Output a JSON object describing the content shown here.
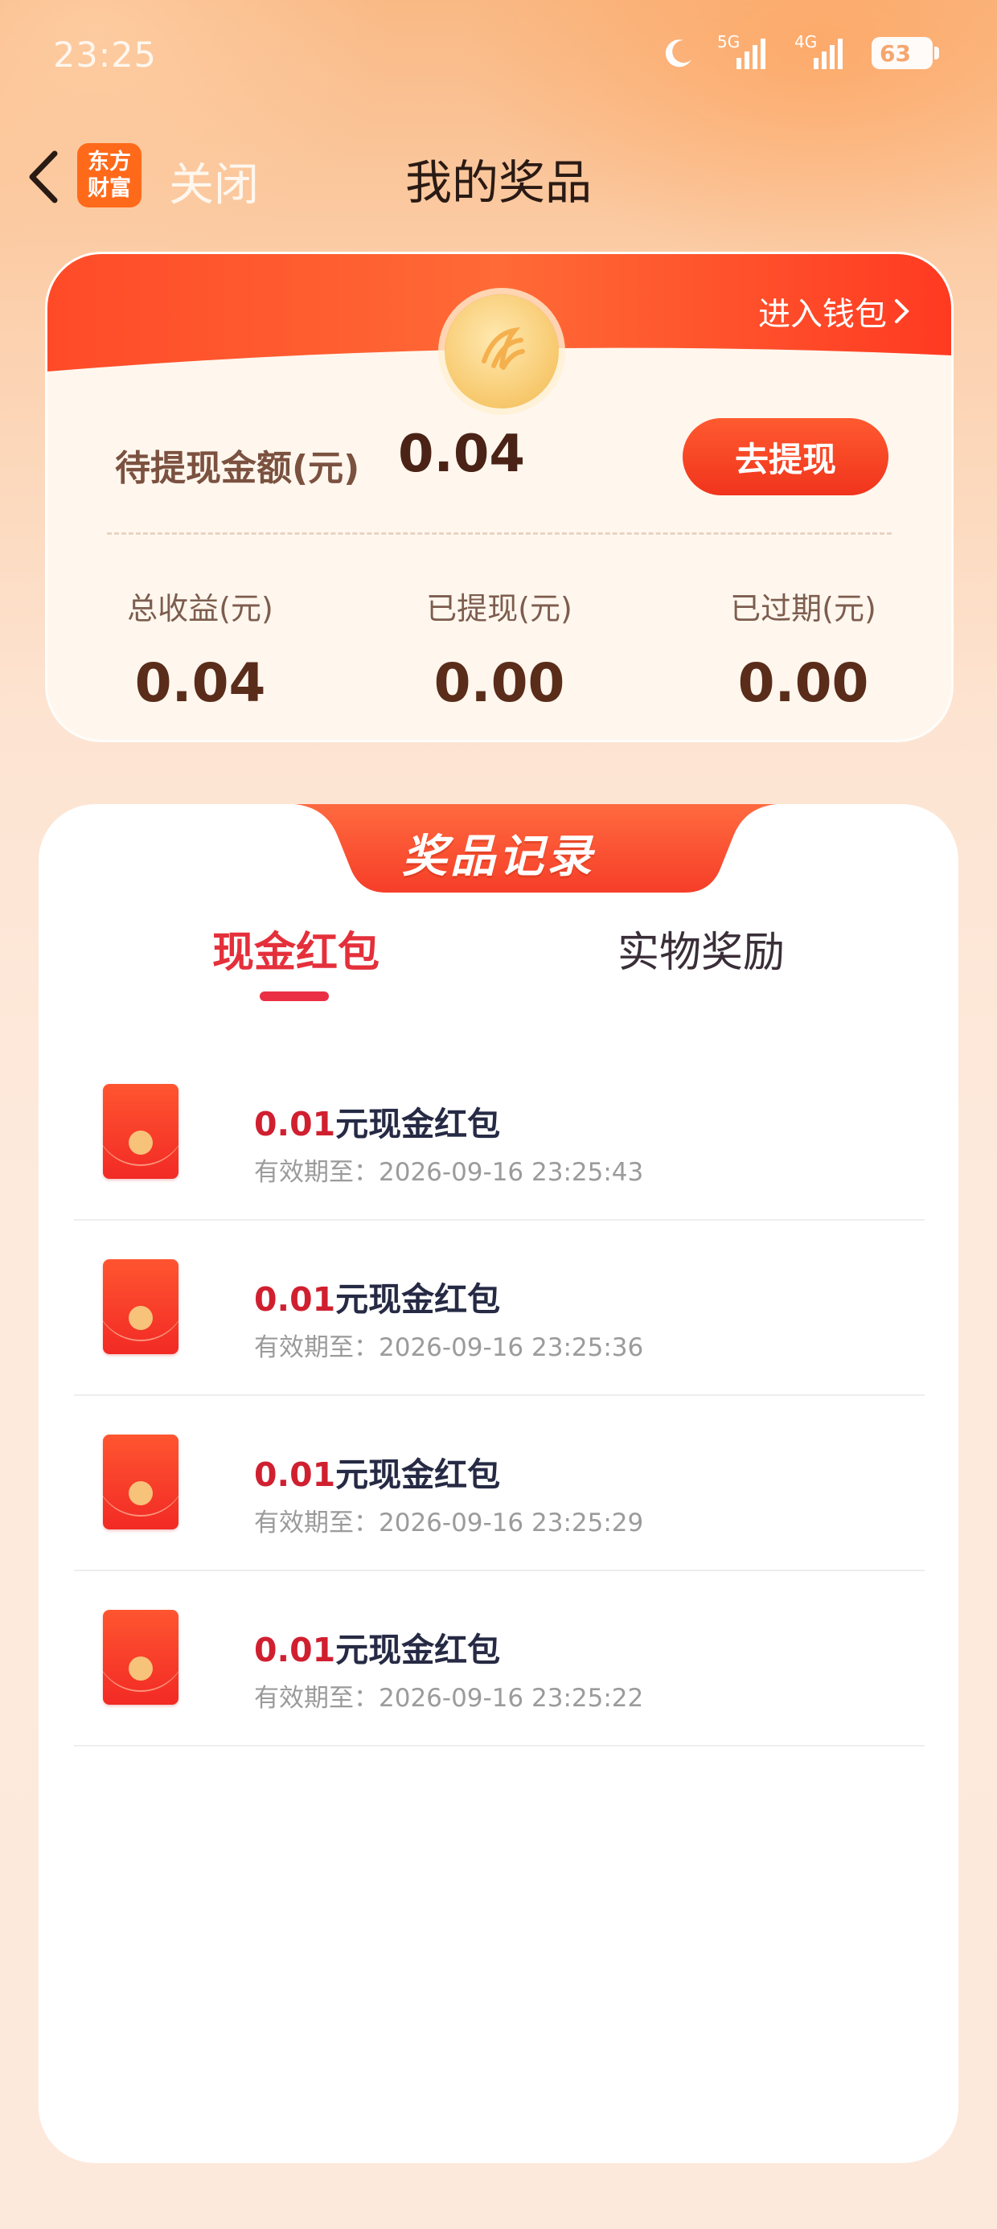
{
  "status_bar": {
    "time": "23:25",
    "network1": "5G",
    "network2": "4G",
    "battery": "63"
  },
  "nav": {
    "close_label": "关闭",
    "title": "我的奖品",
    "logo_line1": "东方",
    "logo_line2": "财富"
  },
  "wallet": {
    "enter_wallet": "进入钱包",
    "pending_label": "待提现金额(元)",
    "pending_value": "0.04",
    "withdraw_button": "去提现",
    "stats": [
      {
        "label": "总收益(元)",
        "value": "0.04"
      },
      {
        "label": "已提现(元)",
        "value": "0.00"
      },
      {
        "label": "已过期(元)",
        "value": "0.00"
      }
    ]
  },
  "records": {
    "title": "奖品记录",
    "tabs": [
      {
        "label": "现金红包",
        "active": true
      },
      {
        "label": "实物奖励",
        "active": false
      }
    ],
    "items": [
      {
        "amount": "0.01",
        "name": "元现金红包",
        "expiry": "有效期至：2026-09-16 23:25:43"
      },
      {
        "amount": "0.01",
        "name": "元现金红包",
        "expiry": "有效期至：2026-09-16 23:25:36"
      },
      {
        "amount": "0.01",
        "name": "元现金红包",
        "expiry": "有效期至：2026-09-16 23:25:29"
      },
      {
        "amount": "0.01",
        "name": "元现金红包",
        "expiry": "有效期至：2026-09-16 23:25:22"
      }
    ]
  },
  "colors": {
    "accent_red": "#e4303b",
    "button_orange": "#f0341c",
    "amount_red": "#d02030"
  }
}
